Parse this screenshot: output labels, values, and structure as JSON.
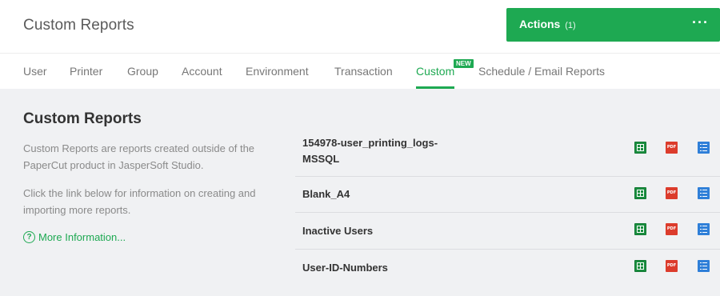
{
  "header": {
    "title": "Custom Reports",
    "actions": {
      "label": "Actions",
      "count": "(1)",
      "more": "···"
    }
  },
  "tabs": [
    {
      "label": "User"
    },
    {
      "label": "Printer"
    },
    {
      "label": "Group"
    },
    {
      "label": "Account"
    },
    {
      "label": "Environment"
    },
    {
      "label": "Transaction"
    },
    {
      "label": "Custom",
      "active": true,
      "badge": "NEW"
    },
    {
      "label": "Schedule / Email Reports"
    }
  ],
  "main": {
    "title": "Custom Reports",
    "description_1": "Custom Reports are reports created outside of the PaperCut product in JasperSoft Studio.",
    "description_2": "Click the link below for information on creating and importing more reports.",
    "more_info": "More Information...",
    "help_icon_glyph": "?",
    "pdf_label": "PDF"
  },
  "reports": [
    {
      "name": "154978-user_printing_logs-MSSQL"
    },
    {
      "name": "Blank_A4"
    },
    {
      "name": "Inactive Users"
    },
    {
      "name": "User-ID-Numbers"
    }
  ],
  "colors": {
    "accent": "#1ea952",
    "pdf": "#dc3c2c",
    "csv": "#2f7fd8",
    "excel": "#1a8d3f",
    "content_bg": "#f0f1f3"
  }
}
